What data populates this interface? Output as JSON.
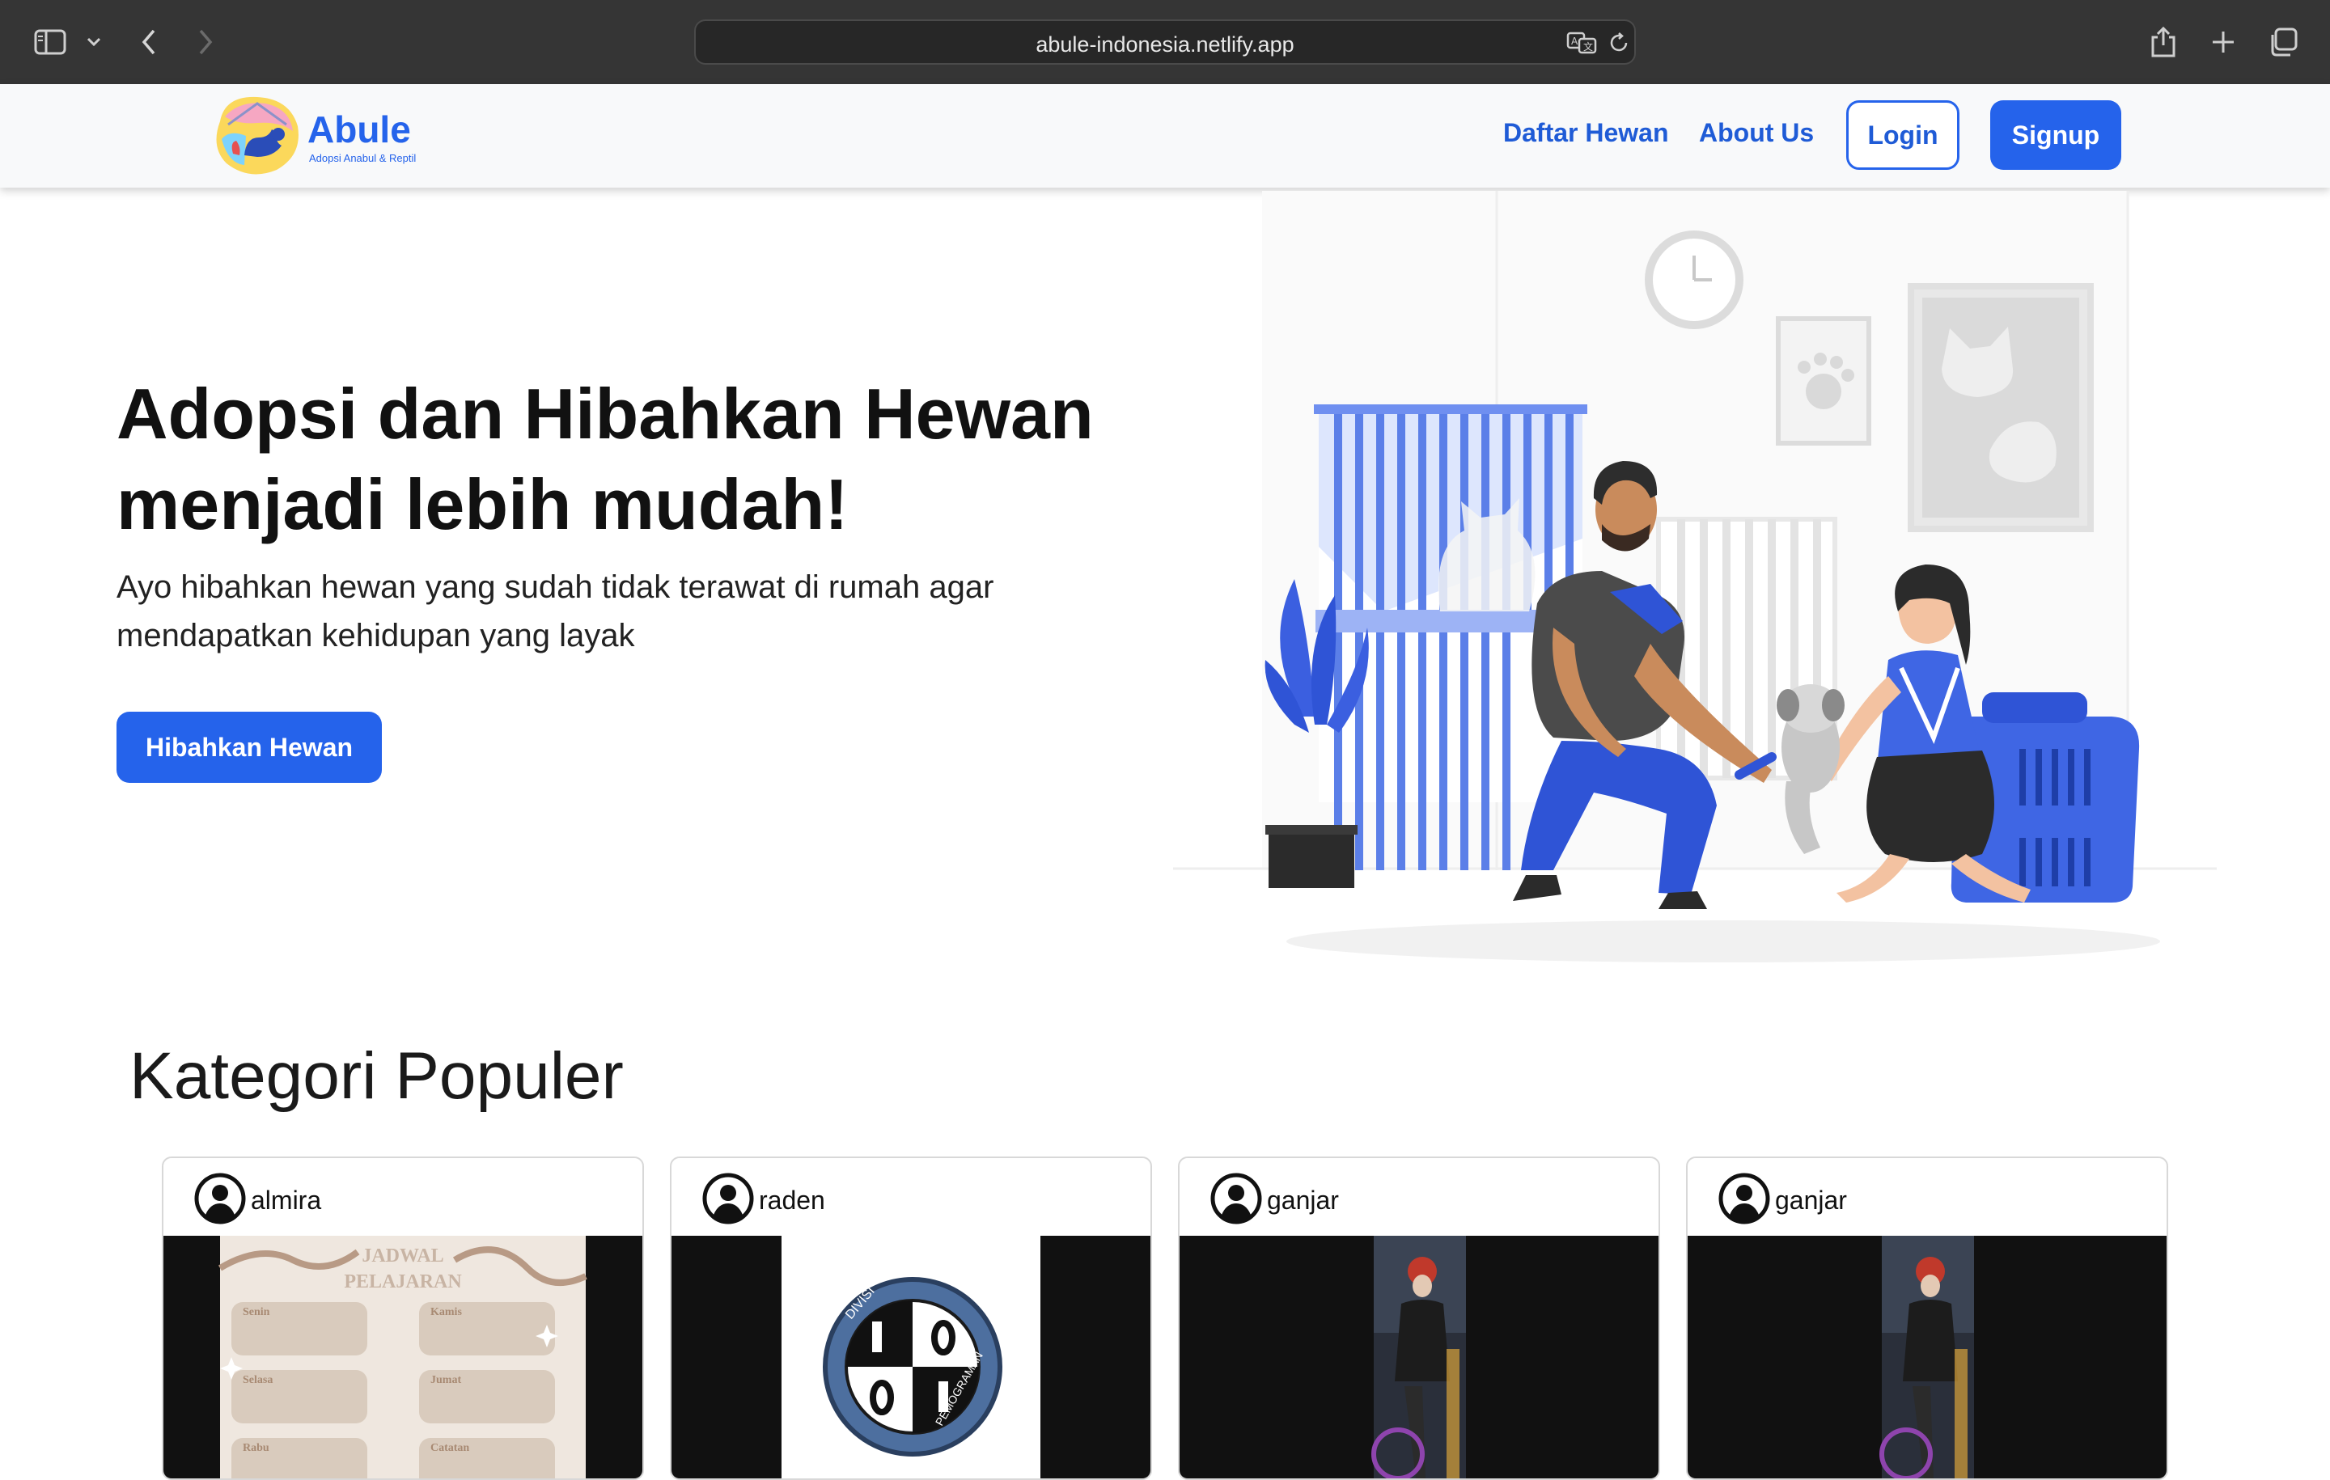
{
  "browser": {
    "url": "abule-indonesia.netlify.app",
    "icons": [
      "sidebar-icon",
      "chevron-down-icon",
      "back-icon",
      "forward-icon",
      "page-icon",
      "translate-icon",
      "reload-icon",
      "share-icon",
      "new-tab-icon",
      "tabs-overview-icon"
    ]
  },
  "header": {
    "logo_text": "Abule",
    "logo_tagline": "Adopsi Anabul & Reptil",
    "nav": {
      "daftar_hewan": "Daftar Hewan",
      "about_us": "About Us"
    },
    "login": "Login",
    "signup": "Signup"
  },
  "hero": {
    "title_line1": "Adopsi dan Hibahkan Hewan",
    "title_line2": "menjadi lebih mudah!",
    "subtitle_line1": "Ayo hibahkan hewan yang sudah tidak terawat di rumah agar",
    "subtitle_line2": "mendapatkan kehidupan yang layak",
    "cta": "Hibahkan Hewan"
  },
  "categories": {
    "title": "Kategori Populer",
    "cards": [
      {
        "user": "almira",
        "image_text": {
          "title1": "JADWAL",
          "title2": "PELAJARAN",
          "days": [
            "Senin",
            "Kamis",
            "Selasa",
            "Jumat",
            "Rabu",
            "Catatan"
          ]
        }
      },
      {
        "user": "raden",
        "image_text": {
          "ring_left": "DIVISI",
          "ring_right": "PEMOGRAMAN"
        }
      },
      {
        "user": "ganjar"
      },
      {
        "user": "ganjar"
      }
    ]
  },
  "colors": {
    "primary": "#2563eb",
    "chrome": "#353535",
    "header_bg": "#f8f9fa"
  }
}
